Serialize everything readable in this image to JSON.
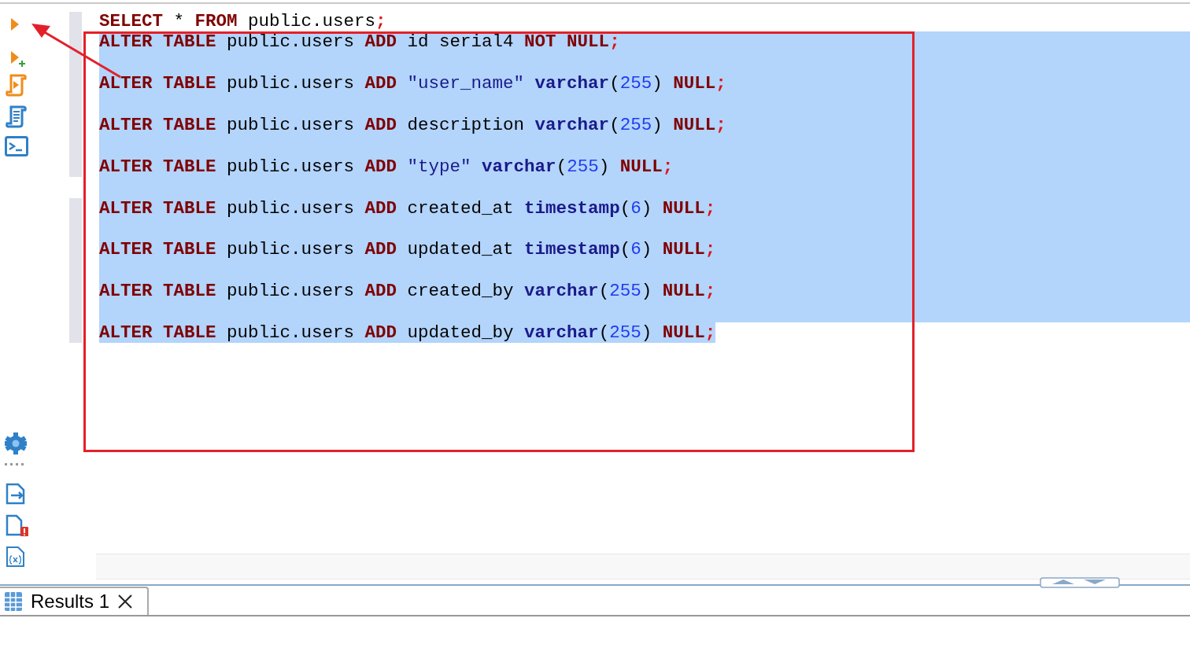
{
  "editor": {
    "lines": [
      {
        "kind": "code",
        "selected": false,
        "tokens": [
          {
            "kind": "keyword",
            "text": "SELECT"
          },
          {
            "kind": "plain",
            "text": " * "
          },
          {
            "kind": "keyword",
            "text": "FROM"
          },
          {
            "kind": "plain",
            "text": " public.users"
          },
          {
            "kind": "punct",
            "text": ";"
          }
        ]
      },
      {
        "kind": "code",
        "selected": true,
        "tokens": [
          {
            "kind": "keyword",
            "text": "ALTER TABLE"
          },
          {
            "kind": "plain",
            "text": " public.users "
          },
          {
            "kind": "keyword",
            "text": "ADD"
          },
          {
            "kind": "plain",
            "text": " id serial4 "
          },
          {
            "kind": "keyword",
            "text": "NOT NULL"
          },
          {
            "kind": "punct",
            "text": ";"
          }
        ]
      },
      {
        "kind": "blank",
        "selected": true
      },
      {
        "kind": "code",
        "selected": true,
        "tokens": [
          {
            "kind": "keyword",
            "text": "ALTER TABLE"
          },
          {
            "kind": "plain",
            "text": " public.users "
          },
          {
            "kind": "keyword",
            "text": "ADD"
          },
          {
            "kind": "string",
            "text": " \"user_name\" "
          },
          {
            "kind": "type",
            "text": "varchar"
          },
          {
            "kind": "plain",
            "text": "("
          },
          {
            "kind": "number",
            "text": "255"
          },
          {
            "kind": "plain",
            "text": ") "
          },
          {
            "kind": "keyword",
            "text": "NULL"
          },
          {
            "kind": "punct",
            "text": ";"
          }
        ]
      },
      {
        "kind": "blank",
        "selected": true
      },
      {
        "kind": "code",
        "selected": true,
        "tokens": [
          {
            "kind": "keyword",
            "text": "ALTER TABLE"
          },
          {
            "kind": "plain",
            "text": " public.users "
          },
          {
            "kind": "keyword",
            "text": "ADD"
          },
          {
            "kind": "plain",
            "text": " description "
          },
          {
            "kind": "type",
            "text": "varchar"
          },
          {
            "kind": "plain",
            "text": "("
          },
          {
            "kind": "number",
            "text": "255"
          },
          {
            "kind": "plain",
            "text": ") "
          },
          {
            "kind": "keyword",
            "text": "NULL"
          },
          {
            "kind": "punct",
            "text": ";"
          }
        ]
      },
      {
        "kind": "blank",
        "selected": true
      },
      {
        "kind": "code",
        "selected": true,
        "tokens": [
          {
            "kind": "keyword",
            "text": "ALTER TABLE"
          },
          {
            "kind": "plain",
            "text": " public.users "
          },
          {
            "kind": "keyword",
            "text": "ADD"
          },
          {
            "kind": "string",
            "text": " \"type\" "
          },
          {
            "kind": "type",
            "text": "varchar"
          },
          {
            "kind": "plain",
            "text": "("
          },
          {
            "kind": "number",
            "text": "255"
          },
          {
            "kind": "plain",
            "text": ") "
          },
          {
            "kind": "keyword",
            "text": "NULL"
          },
          {
            "kind": "punct",
            "text": ";"
          }
        ]
      },
      {
        "kind": "blank",
        "selected": true
      },
      {
        "kind": "code",
        "selected": true,
        "tokens": [
          {
            "kind": "keyword",
            "text": "ALTER TABLE"
          },
          {
            "kind": "plain",
            "text": " public.users "
          },
          {
            "kind": "keyword",
            "text": "ADD"
          },
          {
            "kind": "plain",
            "text": " created_at "
          },
          {
            "kind": "type",
            "text": "timestamp"
          },
          {
            "kind": "plain",
            "text": "("
          },
          {
            "kind": "number",
            "text": "6"
          },
          {
            "kind": "plain",
            "text": ") "
          },
          {
            "kind": "keyword",
            "text": "NULL"
          },
          {
            "kind": "punct",
            "text": ";"
          }
        ]
      },
      {
        "kind": "blank",
        "selected": true
      },
      {
        "kind": "code",
        "selected": true,
        "tokens": [
          {
            "kind": "keyword",
            "text": "ALTER TABLE"
          },
          {
            "kind": "plain",
            "text": " public.users "
          },
          {
            "kind": "keyword",
            "text": "ADD"
          },
          {
            "kind": "plain",
            "text": " updated_at "
          },
          {
            "kind": "type",
            "text": "timestamp"
          },
          {
            "kind": "plain",
            "text": "("
          },
          {
            "kind": "number",
            "text": "6"
          },
          {
            "kind": "plain",
            "text": ") "
          },
          {
            "kind": "keyword",
            "text": "NULL"
          },
          {
            "kind": "punct",
            "text": ";"
          }
        ]
      },
      {
        "kind": "blank",
        "selected": true
      },
      {
        "kind": "code",
        "selected": true,
        "tokens": [
          {
            "kind": "keyword",
            "text": "ALTER TABLE"
          },
          {
            "kind": "plain",
            "text": " public.users "
          },
          {
            "kind": "keyword",
            "text": "ADD"
          },
          {
            "kind": "plain",
            "text": " created_by "
          },
          {
            "kind": "type",
            "text": "varchar"
          },
          {
            "kind": "plain",
            "text": "("
          },
          {
            "kind": "number",
            "text": "255"
          },
          {
            "kind": "plain",
            "text": ") "
          },
          {
            "kind": "keyword",
            "text": "NULL"
          },
          {
            "kind": "punct",
            "text": ";"
          }
        ]
      },
      {
        "kind": "blank",
        "selected": true
      },
      {
        "kind": "code",
        "selected": true,
        "tokens": [
          {
            "kind": "keyword",
            "text": "ALTER TABLE"
          },
          {
            "kind": "plain",
            "text": " public.users "
          },
          {
            "kind": "keyword",
            "text": "ADD"
          },
          {
            "kind": "plain",
            "text": " updated_by "
          },
          {
            "kind": "type",
            "text": "varchar"
          },
          {
            "kind": "plain",
            "text": "("
          },
          {
            "kind": "number",
            "text": "255"
          },
          {
            "kind": "plain",
            "text": ") "
          },
          {
            "kind": "keyword",
            "text": "NULL"
          },
          {
            "kind": "punct",
            "text": ";"
          }
        ]
      }
    ]
  },
  "results_tabs": [
    {
      "label": "Results 1",
      "selected": true
    }
  ]
}
